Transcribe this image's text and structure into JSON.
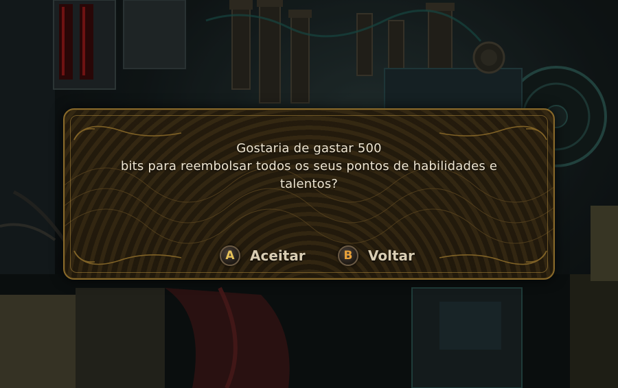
{
  "dialog": {
    "message_lines": [
      "Gostaria de gastar 500",
      "bits para reembolsar todos os seus pontos de habilidades e",
      "talentos?"
    ],
    "accept": {
      "button_glyph": "A",
      "label": "Aceitar",
      "glyph_color": "#e6c25a"
    },
    "back": {
      "button_glyph": "B",
      "label": "Voltar",
      "glyph_color": "#e8a13a"
    }
  },
  "theme": {
    "frame_color": "#8a6a2a",
    "panel_color": "#241c0d",
    "text_color": "#efe6d2"
  }
}
